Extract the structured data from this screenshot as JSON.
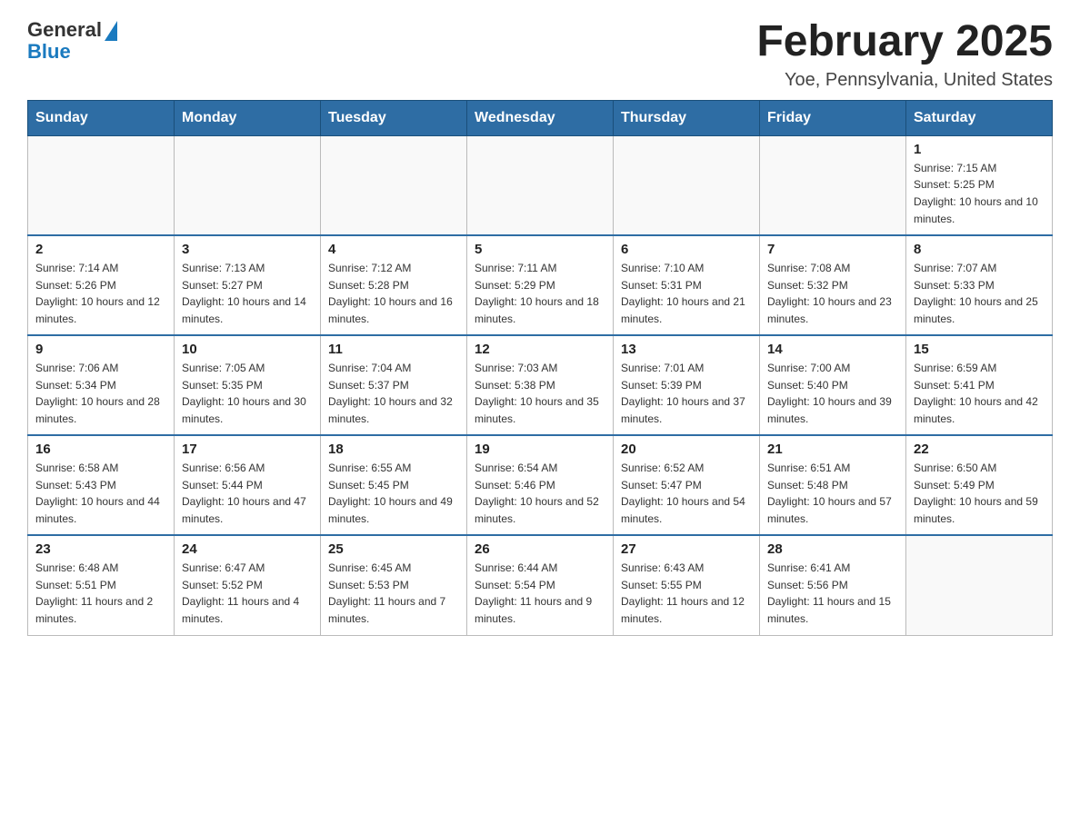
{
  "header": {
    "logo_general": "General",
    "logo_blue": "Blue",
    "main_title": "February 2025",
    "subtitle": "Yoe, Pennsylvania, United States"
  },
  "weekdays": [
    "Sunday",
    "Monday",
    "Tuesday",
    "Wednesday",
    "Thursday",
    "Friday",
    "Saturday"
  ],
  "weeks": [
    [
      {
        "day": "",
        "info": ""
      },
      {
        "day": "",
        "info": ""
      },
      {
        "day": "",
        "info": ""
      },
      {
        "day": "",
        "info": ""
      },
      {
        "day": "",
        "info": ""
      },
      {
        "day": "",
        "info": ""
      },
      {
        "day": "1",
        "info": "Sunrise: 7:15 AM\nSunset: 5:25 PM\nDaylight: 10 hours and 10 minutes."
      }
    ],
    [
      {
        "day": "2",
        "info": "Sunrise: 7:14 AM\nSunset: 5:26 PM\nDaylight: 10 hours and 12 minutes."
      },
      {
        "day": "3",
        "info": "Sunrise: 7:13 AM\nSunset: 5:27 PM\nDaylight: 10 hours and 14 minutes."
      },
      {
        "day": "4",
        "info": "Sunrise: 7:12 AM\nSunset: 5:28 PM\nDaylight: 10 hours and 16 minutes."
      },
      {
        "day": "5",
        "info": "Sunrise: 7:11 AM\nSunset: 5:29 PM\nDaylight: 10 hours and 18 minutes."
      },
      {
        "day": "6",
        "info": "Sunrise: 7:10 AM\nSunset: 5:31 PM\nDaylight: 10 hours and 21 minutes."
      },
      {
        "day": "7",
        "info": "Sunrise: 7:08 AM\nSunset: 5:32 PM\nDaylight: 10 hours and 23 minutes."
      },
      {
        "day": "8",
        "info": "Sunrise: 7:07 AM\nSunset: 5:33 PM\nDaylight: 10 hours and 25 minutes."
      }
    ],
    [
      {
        "day": "9",
        "info": "Sunrise: 7:06 AM\nSunset: 5:34 PM\nDaylight: 10 hours and 28 minutes."
      },
      {
        "day": "10",
        "info": "Sunrise: 7:05 AM\nSunset: 5:35 PM\nDaylight: 10 hours and 30 minutes."
      },
      {
        "day": "11",
        "info": "Sunrise: 7:04 AM\nSunset: 5:37 PM\nDaylight: 10 hours and 32 minutes."
      },
      {
        "day": "12",
        "info": "Sunrise: 7:03 AM\nSunset: 5:38 PM\nDaylight: 10 hours and 35 minutes."
      },
      {
        "day": "13",
        "info": "Sunrise: 7:01 AM\nSunset: 5:39 PM\nDaylight: 10 hours and 37 minutes."
      },
      {
        "day": "14",
        "info": "Sunrise: 7:00 AM\nSunset: 5:40 PM\nDaylight: 10 hours and 39 minutes."
      },
      {
        "day": "15",
        "info": "Sunrise: 6:59 AM\nSunset: 5:41 PM\nDaylight: 10 hours and 42 minutes."
      }
    ],
    [
      {
        "day": "16",
        "info": "Sunrise: 6:58 AM\nSunset: 5:43 PM\nDaylight: 10 hours and 44 minutes."
      },
      {
        "day": "17",
        "info": "Sunrise: 6:56 AM\nSunset: 5:44 PM\nDaylight: 10 hours and 47 minutes."
      },
      {
        "day": "18",
        "info": "Sunrise: 6:55 AM\nSunset: 5:45 PM\nDaylight: 10 hours and 49 minutes."
      },
      {
        "day": "19",
        "info": "Sunrise: 6:54 AM\nSunset: 5:46 PM\nDaylight: 10 hours and 52 minutes."
      },
      {
        "day": "20",
        "info": "Sunrise: 6:52 AM\nSunset: 5:47 PM\nDaylight: 10 hours and 54 minutes."
      },
      {
        "day": "21",
        "info": "Sunrise: 6:51 AM\nSunset: 5:48 PM\nDaylight: 10 hours and 57 minutes."
      },
      {
        "day": "22",
        "info": "Sunrise: 6:50 AM\nSunset: 5:49 PM\nDaylight: 10 hours and 59 minutes."
      }
    ],
    [
      {
        "day": "23",
        "info": "Sunrise: 6:48 AM\nSunset: 5:51 PM\nDaylight: 11 hours and 2 minutes."
      },
      {
        "day": "24",
        "info": "Sunrise: 6:47 AM\nSunset: 5:52 PM\nDaylight: 11 hours and 4 minutes."
      },
      {
        "day": "25",
        "info": "Sunrise: 6:45 AM\nSunset: 5:53 PM\nDaylight: 11 hours and 7 minutes."
      },
      {
        "day": "26",
        "info": "Sunrise: 6:44 AM\nSunset: 5:54 PM\nDaylight: 11 hours and 9 minutes."
      },
      {
        "day": "27",
        "info": "Sunrise: 6:43 AM\nSunset: 5:55 PM\nDaylight: 11 hours and 12 minutes."
      },
      {
        "day": "28",
        "info": "Sunrise: 6:41 AM\nSunset: 5:56 PM\nDaylight: 11 hours and 15 minutes."
      },
      {
        "day": "",
        "info": ""
      }
    ]
  ]
}
